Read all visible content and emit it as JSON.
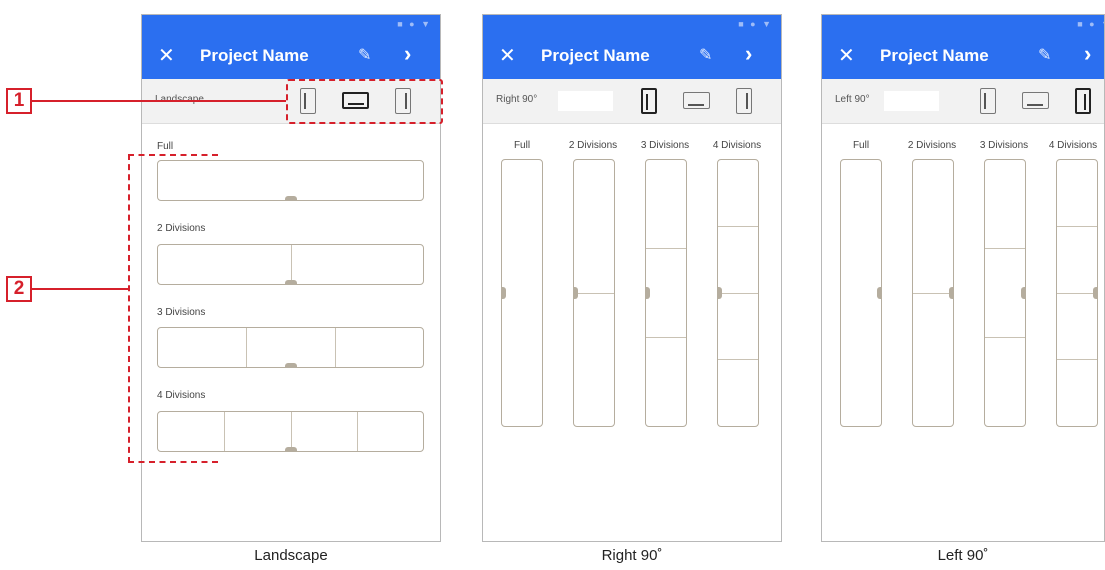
{
  "app": {
    "title": "Project Name"
  },
  "icons": {
    "close": "close-icon",
    "edit": "pencil-icon",
    "next": "chevron-right-icon",
    "orientation_left": "portrait-left-icon",
    "orientation_landscape": "landscape-icon",
    "orientation_right": "portrait-right-icon"
  },
  "accent_color": "#2b6ff0",
  "callout_color": "#d6202b",
  "callouts": [
    "1",
    "2"
  ],
  "screens": [
    {
      "orientation_label": "Landscape",
      "caption": "Landscape",
      "active": "landscape",
      "sections": [
        "Full",
        "2 Divisions",
        "3 Divisions",
        "4 Divisions"
      ]
    },
    {
      "orientation_label": "Right 90°",
      "caption": "Right 90˚",
      "active": "left",
      "columns": [
        "Full",
        "2 Divisions",
        "3 Divisions",
        "4 Divisions"
      ]
    },
    {
      "orientation_label": "Left 90°",
      "caption": "Left 90˚",
      "active": "right",
      "columns": [
        "Full",
        "2 Divisions",
        "3 Divisions",
        "4 Divisions"
      ]
    }
  ]
}
